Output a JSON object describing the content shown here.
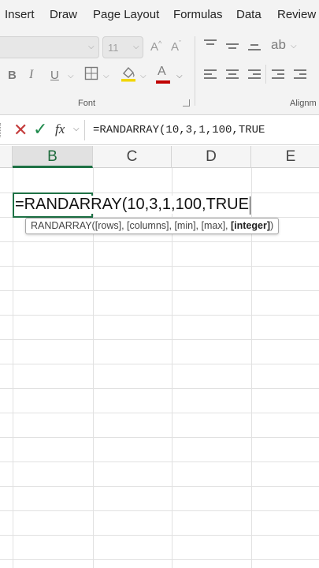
{
  "ribbon": {
    "tabs": [
      "Insert",
      "Draw",
      "Page Layout",
      "Formulas",
      "Data",
      "Review"
    ],
    "font_size_value": "11",
    "grow_font": "A",
    "shrink_font": "A",
    "bold": "B",
    "italic": "I",
    "underline": "U",
    "font_color_glyph": "A",
    "highlight_color": "#f1d600",
    "font_color": "#c00000",
    "font_group_label": "Font",
    "alignment_group_label": "Alignm"
  },
  "formula_bar": {
    "cancel_glyph": "✕",
    "enter_glyph": "✓",
    "fx_label": "fx",
    "formula": "=RANDARRAY(10,3,1,100,TRUE"
  },
  "grid": {
    "columns": [
      "B",
      "C",
      "D",
      "E"
    ],
    "active_column": "B",
    "active_cell_text": "=RANDARRAY(10,3,1,100,TRUE",
    "accent_color": "#1e7145"
  },
  "tooltip": {
    "func": "RANDARRAY(",
    "args": "[rows], [columns], [min], [max], ",
    "current_arg": "[integer]",
    "close": ")"
  }
}
